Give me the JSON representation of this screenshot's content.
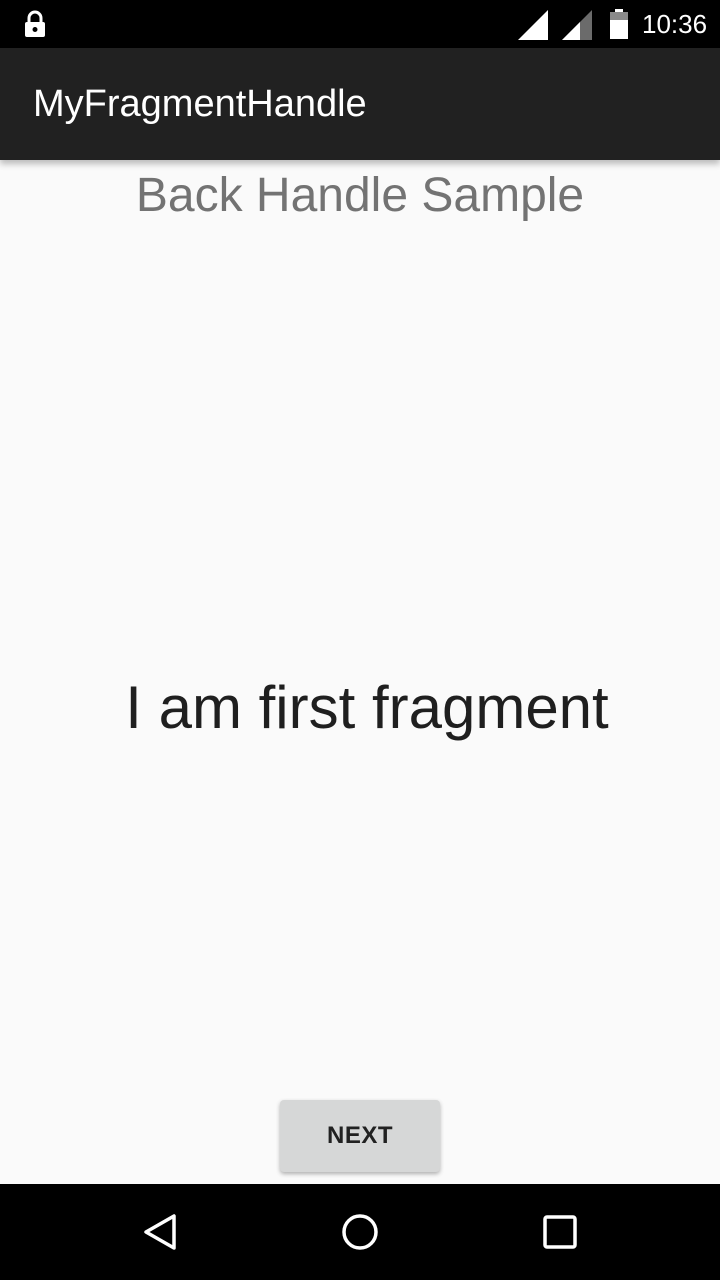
{
  "status_bar": {
    "time": "10:36",
    "icons": [
      "lock-icon",
      "signal-icon",
      "signal-icon",
      "battery-icon"
    ]
  },
  "app_bar": {
    "title": "MyFragmentHandle"
  },
  "main": {
    "subtitle": "Back Handle Sample",
    "fragment_text": "I am first fragment",
    "next_label": "NEXT"
  },
  "nav_bar": {
    "icons": [
      "back-icon",
      "home-icon",
      "recents-icon"
    ]
  },
  "colors": {
    "status_bar": "#000000",
    "app_bar": "#212121",
    "background": "#fafafa",
    "button": "#d6d7d7",
    "subtitle_text": "#737373"
  }
}
